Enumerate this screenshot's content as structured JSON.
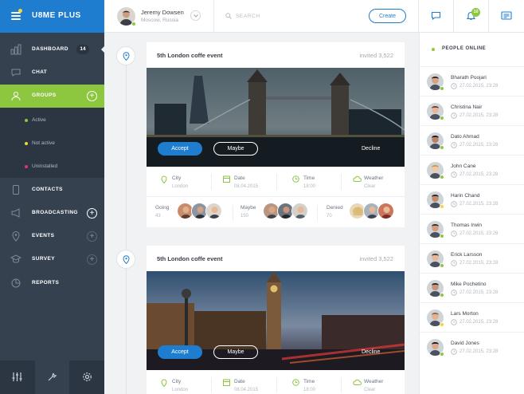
{
  "brand": {
    "title": "U8ME PLUS"
  },
  "colors": {
    "primary": "#1f7dd0",
    "accent": "#8dc63f",
    "sidebar": "#35414f",
    "yellow": "#f5d633",
    "pink": "#e4307a"
  },
  "nav": {
    "dashboard": {
      "label": "DASHBOARD",
      "badge": "14",
      "icon": "dashboard-bars-icon"
    },
    "chat": {
      "label": "CHAT",
      "icon": "chat-bubble-icon"
    },
    "groups": {
      "label": "GROUPS",
      "icon": "users-icon",
      "sub": [
        {
          "label": "Active",
          "color": "#8dc63f"
        },
        {
          "label": "Not active",
          "color": "#f5d633"
        },
        {
          "label": "Uninstalled",
          "color": "#e4307a"
        }
      ]
    },
    "contacts": {
      "label": "CONTACTS",
      "icon": "phone-icon"
    },
    "broadcasting": {
      "label": "BROADCASTING",
      "icon": "megaphone-icon"
    },
    "events": {
      "label": "EVENTS",
      "icon": "location-pin-icon"
    },
    "survey": {
      "label": "SURVEY",
      "icon": "graduation-cap-icon"
    },
    "reports": {
      "label": "REPORTS",
      "icon": "pie-chart-icon"
    }
  },
  "header": {
    "user_name": "Jeremy Dowsen",
    "user_location": "Moscow, Russia",
    "search_placeholder": "SEARCH",
    "create_label": "Create",
    "notification_count": "10"
  },
  "events": [
    {
      "title": "5th London coffe event",
      "invited": "invited 3,522",
      "accept": "Accept",
      "maybe": "Maybe",
      "decline": "Decline",
      "city_label": "City",
      "city": "London",
      "date_label": "Date",
      "date": "08.04.2015",
      "time_label": "Time",
      "time": "18:00",
      "weather_label": "Weather",
      "weather": "Clear",
      "going_label": "Going",
      "going_count": "43",
      "maybe_label": "Maybe",
      "maybe_count": "150",
      "denied_label": "Denied",
      "denied_count": "70"
    },
    {
      "title": "5th London coffe event",
      "invited": "invited 3,522",
      "accept": "Accept",
      "maybe": "Maybe",
      "decline": "Decline",
      "city_label": "City",
      "city": "London",
      "date_label": "Date",
      "date": "08.04.2015",
      "time_label": "Time",
      "time": "18:00",
      "weather_label": "Weather",
      "weather": "Clear"
    }
  ],
  "people_online": {
    "title": "PEOPLE ONLINE",
    "people": [
      {
        "name": "Bharath Poojari",
        "time": "27.02.2015, 23:28",
        "status": "#8dc63f"
      },
      {
        "name": "Christina Nair",
        "time": "27.02.2015, 23:28",
        "status": "#8dc63f"
      },
      {
        "name": "Dato Ahmad",
        "time": "27.02.2015, 23:28",
        "status": "#8dc63f"
      },
      {
        "name": "John Cane",
        "time": "27.02.2015, 23:28",
        "status": "#8dc63f"
      },
      {
        "name": "Harin Chand",
        "time": "27.02.2015, 23:28",
        "status": "#f5d633"
      },
      {
        "name": "Thomas Irwin",
        "time": "27.02.2015, 23:28",
        "status": "#8dc63f"
      },
      {
        "name": "Erick Larsson",
        "time": "27.02.2015, 23:28",
        "status": "#8dc63f"
      },
      {
        "name": "Mike Pochetino",
        "time": "27.02.2015, 23:28",
        "status": "#8dc63f"
      },
      {
        "name": "Lars Morton",
        "time": "27.02.2015, 23:28",
        "status": "#f5d633"
      },
      {
        "name": "David Jones",
        "time": "27.02.2015, 23:28",
        "status": "#8dc63f"
      }
    ]
  }
}
